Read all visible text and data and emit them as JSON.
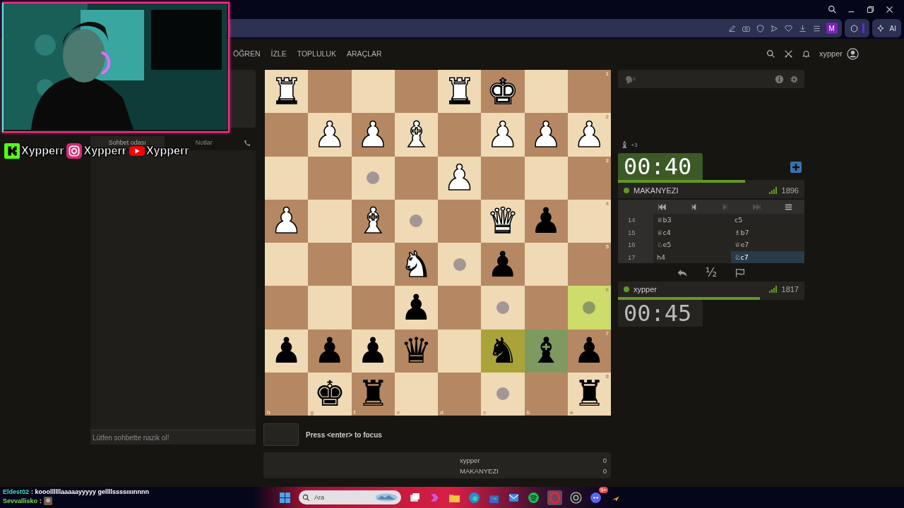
{
  "socials": [
    {
      "kind": "kick",
      "handle": "Xypperr"
    },
    {
      "kind": "instagram",
      "handle": "Xypperr"
    },
    {
      "kind": "youtube",
      "handle": "Xypperr"
    }
  ],
  "browser": {
    "profile_initial": "M",
    "ai_label": "AI"
  },
  "nav": {
    "items": [
      "ÖĞREN",
      "İZLE",
      "TOPLULUK",
      "ARAÇLAR"
    ],
    "username": "xypper"
  },
  "chat": {
    "tabs": [
      {
        "label": "Sohbet odası",
        "selected": true
      },
      {
        "label": "Notlar",
        "selected": false
      }
    ],
    "placeholder": "Lütfen sohbette nazik ol!"
  },
  "board": {
    "files": [
      "h",
      "g",
      "f",
      "e",
      "d",
      "c",
      "b",
      "a"
    ],
    "ranks": [
      "1",
      "2",
      "3",
      "4",
      "5",
      "6",
      "7",
      "8"
    ],
    "rows": [
      [
        {
          "piece": "♜",
          "white": true
        },
        {},
        {},
        {},
        {
          "piece": "♜",
          "white": true
        },
        {
          "piece": "♚",
          "white": true
        },
        {},
        {}
      ],
      [
        {},
        {
          "piece": "♟",
          "white": true
        },
        {
          "piece": "♟",
          "white": true
        },
        {
          "piece": "♝",
          "white": true
        },
        {},
        {
          "piece": "♟",
          "white": true
        },
        {
          "piece": "♟",
          "white": true
        },
        {
          "piece": "♟",
          "white": true
        }
      ],
      [
        {},
        {},
        {
          "dot": true
        },
        {},
        {
          "piece": "♟",
          "white": true
        },
        {},
        {},
        {}
      ],
      [
        {
          "piece": "♟",
          "white": true
        },
        {},
        {
          "piece": "♝",
          "white": true
        },
        {
          "dot": true
        },
        {},
        {
          "piece": "♛",
          "white": true
        },
        {
          "piece": "♟",
          "white": false
        },
        {}
      ],
      [
        {},
        {},
        {},
        {
          "piece": "♞",
          "white": true
        },
        {
          "dot": true
        },
        {
          "piece": "♟",
          "white": false
        },
        {},
        {}
      ],
      [
        {},
        {},
        {},
        {
          "piece": "♟",
          "white": false
        },
        {},
        {
          "dot": true
        },
        {},
        {
          "dot": true,
          "hovered": true
        }
      ],
      [
        {
          "piece": "♟",
          "white": false
        },
        {
          "piece": "♟",
          "white": false
        },
        {
          "piece": "♟",
          "white": false
        },
        {
          "piece": "♛",
          "white": false
        },
        {},
        {
          "piece": "♞",
          "white": false,
          "last_move": true
        },
        {
          "piece": "♝",
          "white": false,
          "selected": true
        },
        {
          "piece": "♟",
          "white": false
        }
      ],
      [
        {},
        {
          "piece": "♚",
          "white": false
        },
        {
          "piece": "♜",
          "white": false
        },
        {},
        {},
        {
          "dot": true
        },
        {},
        {
          "piece": "♜",
          "white": false
        }
      ]
    ]
  },
  "keyboard_hint": "Press <enter> to focus",
  "scores": [
    {
      "name": "xypper",
      "score": "0"
    },
    {
      "name": "MAKANYEZI",
      "score": "0"
    }
  ],
  "material": {
    "piece": "♝",
    "diff": "+3"
  },
  "opponent": {
    "clock": "00:40",
    "running": true,
    "level": 0.68,
    "name": "MAKANYEZI",
    "online": true,
    "rating": "1896"
  },
  "moves": [
    {
      "number": "14",
      "plies": [
        {
          "san": "♕b3",
          "selected": false
        },
        {
          "san": "c5",
          "selected": false
        }
      ]
    },
    {
      "number": "15",
      "plies": [
        {
          "san": "♕c4",
          "selected": false
        },
        {
          "san": "♗b7",
          "selected": false
        }
      ]
    },
    {
      "number": "16",
      "plies": [
        {
          "san": "♘e5",
          "selected": false
        },
        {
          "san": "♕e7",
          "selected": false
        }
      ]
    },
    {
      "number": "17",
      "plies": [
        {
          "san": "h4",
          "selected": false
        },
        {
          "san": "♘c7",
          "selected": true
        }
      ]
    }
  ],
  "draw_offer": "½",
  "player": {
    "clock": "00:45",
    "running": false,
    "level": 0.76,
    "name": "xypper",
    "online": true,
    "rating": "1817"
  },
  "stream_chat": [
    {
      "user": "Eldest02",
      "color": "#4fd6c0",
      "text": ": kooollllllaaaaayyyyy gellllssssıııınnnn",
      "emote": false
    },
    {
      "user": "Sevvallisko",
      "color": "#7ddc52",
      "text": ":",
      "emote": true
    }
  ],
  "taskbar": {
    "search_placeholder": "Ara",
    "discord_badge": "9+"
  }
}
